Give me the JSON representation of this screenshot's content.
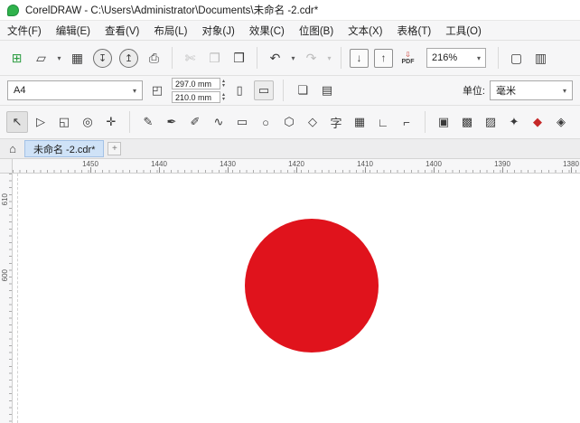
{
  "ui": {
    "dropdown_glyph": "▾",
    "spin_up": "▴",
    "spin_down": "▾"
  },
  "titlebar": {
    "title": "CorelDRAW - C:\\Users\\Administrator\\Documents\\未命名 -2.cdr*"
  },
  "menubar": {
    "items": [
      {
        "name": "menu-file",
        "label": "文件(F)"
      },
      {
        "name": "menu-edit",
        "label": "编辑(E)"
      },
      {
        "name": "menu-view",
        "label": "查看(V)"
      },
      {
        "name": "menu-layout",
        "label": "布局(L)"
      },
      {
        "name": "menu-object",
        "label": "对象(J)"
      },
      {
        "name": "menu-effects",
        "label": "效果(C)"
      },
      {
        "name": "menu-bitmaps",
        "label": "位图(B)"
      },
      {
        "name": "menu-text",
        "label": "文本(X)"
      },
      {
        "name": "menu-table",
        "label": "表格(T)"
      },
      {
        "name": "menu-tools",
        "label": "工具(O)"
      }
    ]
  },
  "standard_toolbar": {
    "zoom_value": "216%",
    "pdf_label": "PDF",
    "pdf_arrow": "⇩",
    "group_file": [
      {
        "name": "new-document-icon",
        "glyph": "⊞",
        "style": "color:#2f9e44"
      },
      {
        "name": "open-folder-icon",
        "glyph": "▱"
      },
      {
        "name": "open-dropdown-icon",
        "glyph": "▾",
        "state": "dd"
      },
      {
        "name": "save-icon",
        "glyph": "▦"
      }
    ],
    "group_cloud": [
      {
        "name": "cloud-download-icon",
        "glyph": "↧",
        "state": "circle active"
      },
      {
        "name": "cloud-upload-icon",
        "glyph": "↥",
        "state": "circle active"
      }
    ],
    "group_print": [
      {
        "name": "print-icon",
        "glyph": "⎙"
      }
    ],
    "group_clipboard": [
      {
        "name": "cut-icon",
        "glyph": "✄",
        "state": "disabled"
      },
      {
        "name": "copy-icon",
        "glyph": "❐",
        "state": "disabled"
      },
      {
        "name": "paste-icon",
        "glyph": "❒"
      }
    ],
    "group_undo": [
      {
        "name": "undo-icon",
        "glyph": "↶"
      },
      {
        "name": "undo-dropdown-icon",
        "glyph": "▾",
        "state": "dd"
      },
      {
        "name": "redo-icon",
        "glyph": "↷",
        "state": "disabled"
      },
      {
        "name": "redo-dropdown-icon",
        "glyph": "▾",
        "state": "dd disabled"
      }
    ],
    "group_impexp": [
      {
        "name": "import-icon",
        "glyph": "↓",
        "state": "boxed"
      },
      {
        "name": "export-icon",
        "glyph": "↑",
        "state": "boxed"
      }
    ],
    "group_view": [
      {
        "name": "fullscreen-icon",
        "glyph": "▢"
      },
      {
        "name": "show-rulers-icon",
        "glyph": "▥"
      }
    ]
  },
  "prop_bar": {
    "page_size": "A4",
    "width": "297.0 mm",
    "height": "210.0 mm",
    "page_metrics_glyph": "◰",
    "portrait_glyph": "▯",
    "landscape_glyph": "▭",
    "all_pages_glyph": "❏",
    "current_page_glyph": "▤",
    "units_label": "单位:",
    "units_value": "毫米"
  },
  "toolbox": {
    "group_select": [
      {
        "name": "pick-tool-icon",
        "glyph": "↖",
        "state": "active"
      },
      {
        "name": "shape-tool-icon",
        "glyph": "▷"
      },
      {
        "name": "crop-tool-icon",
        "glyph": "◱"
      },
      {
        "name": "zoom-tool-icon",
        "glyph": "◎"
      },
      {
        "name": "pan-tool-icon",
        "glyph": "✛"
      }
    ],
    "group_draw": [
      {
        "name": "freehand-tool-icon",
        "glyph": "✎"
      },
      {
        "name": "bezier-tool-icon",
        "glyph": "✒"
      },
      {
        "name": "artistic-media-tool-icon",
        "glyph": "✐"
      },
      {
        "name": "curve-tool-icon",
        "glyph": "∿"
      },
      {
        "name": "rectangle-tool-icon",
        "glyph": "▭"
      },
      {
        "name": "ellipse-tool-icon",
        "glyph": "○"
      },
      {
        "name": "polygon-tool-icon",
        "glyph": "⬡"
      },
      {
        "name": "common-shapes-tool-icon",
        "glyph": "◇"
      },
      {
        "name": "text-tool-icon",
        "glyph": "字"
      },
      {
        "name": "table-tool-icon",
        "glyph": "▦"
      },
      {
        "name": "dimension-tool-icon",
        "glyph": "∟"
      },
      {
        "name": "connector-tool-icon",
        "glyph": "⌐"
      }
    ],
    "group_fill": [
      {
        "name": "interactive-fill-tool-icon",
        "glyph": "▣"
      },
      {
        "name": "mesh-fill-tool-icon",
        "glyph": "▩"
      },
      {
        "name": "transparency-tool-icon",
        "glyph": "▨"
      },
      {
        "name": "eyedropper-tool-icon",
        "glyph": "✦"
      },
      {
        "name": "smart-fill-tool-icon",
        "glyph": "◆",
        "style": "color:#c62828"
      },
      {
        "name": "outline-pen-tool-icon",
        "glyph": "◈"
      }
    ]
  },
  "tabbar": {
    "home_glyph": "⌂",
    "document_label": "未命名 -2.cdr*",
    "new_tab_label": "+"
  },
  "rulers": {
    "h_labels": [
      "1450",
      "1440",
      "1430",
      "1420",
      "1410",
      "1400",
      "1390",
      "1380"
    ],
    "v_labels": [
      {
        "label": "610",
        "style": "top:22px"
      },
      {
        "label": "600",
        "style": "top:106px"
      }
    ]
  },
  "canvas": {
    "circle_color": "#e0131c",
    "circle_style": "background:#e0131c"
  }
}
